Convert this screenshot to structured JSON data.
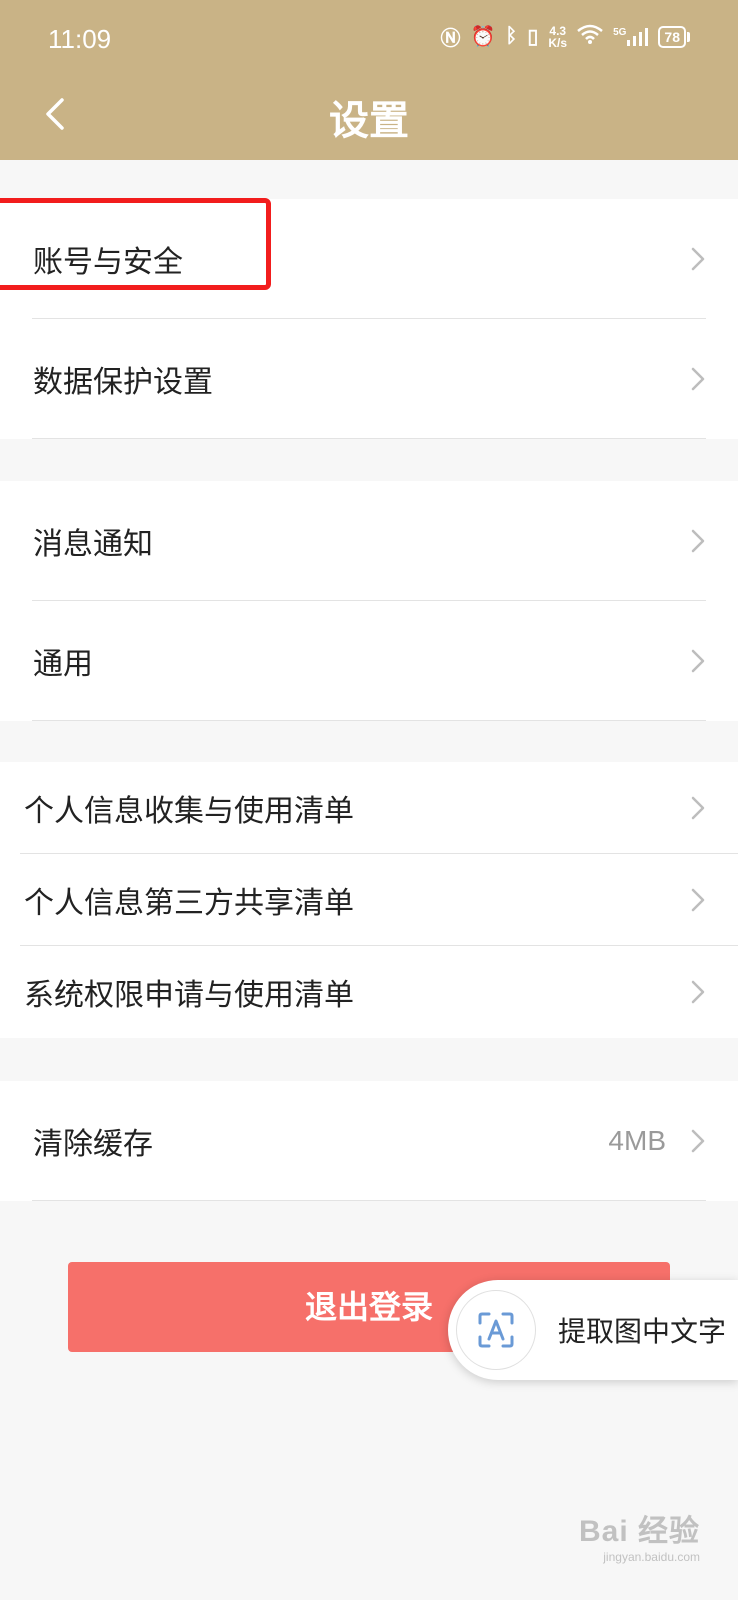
{
  "status_bar": {
    "time": "11:09",
    "icons": [
      "nfc-icon",
      "alarm-icon",
      "bluetooth-icon",
      "vibrate-icon",
      "wifi-icon",
      "signal-icon",
      "battery-icon"
    ],
    "net_speed_value": "4.3",
    "net_speed_unit": "K/s",
    "network_type": "5G",
    "battery_level": "78"
  },
  "header": {
    "title": "设置",
    "color": "#c9b386"
  },
  "sections": [
    {
      "items": [
        {
          "label": "账号与安全",
          "highlighted": true
        },
        {
          "label": "数据保护设置"
        }
      ]
    },
    {
      "items": [
        {
          "label": "消息通知"
        },
        {
          "label": "通用"
        }
      ]
    },
    {
      "items": [
        {
          "label": "个人信息收集与使用清单"
        },
        {
          "label": "个人信息第三方共享清单"
        },
        {
          "label": "系统权限申请与使用清单"
        }
      ]
    },
    {
      "items": [
        {
          "label": "清除缓存",
          "value": "4MB"
        }
      ]
    }
  ],
  "logout": {
    "label": "退出登录",
    "color": "#f6706a"
  },
  "ocr_pill": {
    "label": "提取图中文字",
    "icon": "text-scan-icon"
  },
  "watermark": {
    "main": "Bai 经验",
    "sub": "jingyan.baidu.com"
  },
  "highlight_color": "#f21d1d"
}
